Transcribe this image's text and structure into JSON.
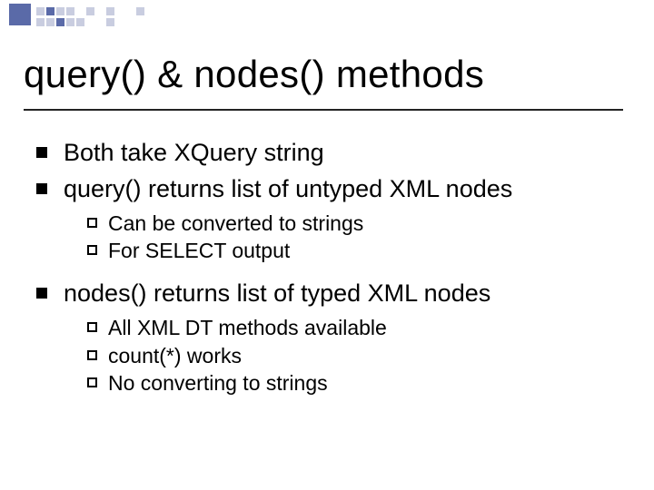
{
  "title": "query() & nodes() methods",
  "bullets": [
    {
      "text": "Both take XQuery string",
      "sub": []
    },
    {
      "text": "query() returns list of untyped XML nodes",
      "sub": [
        "Can be converted to strings",
        "For SELECT output"
      ]
    },
    {
      "text": "nodes() returns list of typed XML nodes",
      "sub": [
        "All XML DT methods available",
        "count(*) works",
        "No converting to strings"
      ]
    }
  ]
}
